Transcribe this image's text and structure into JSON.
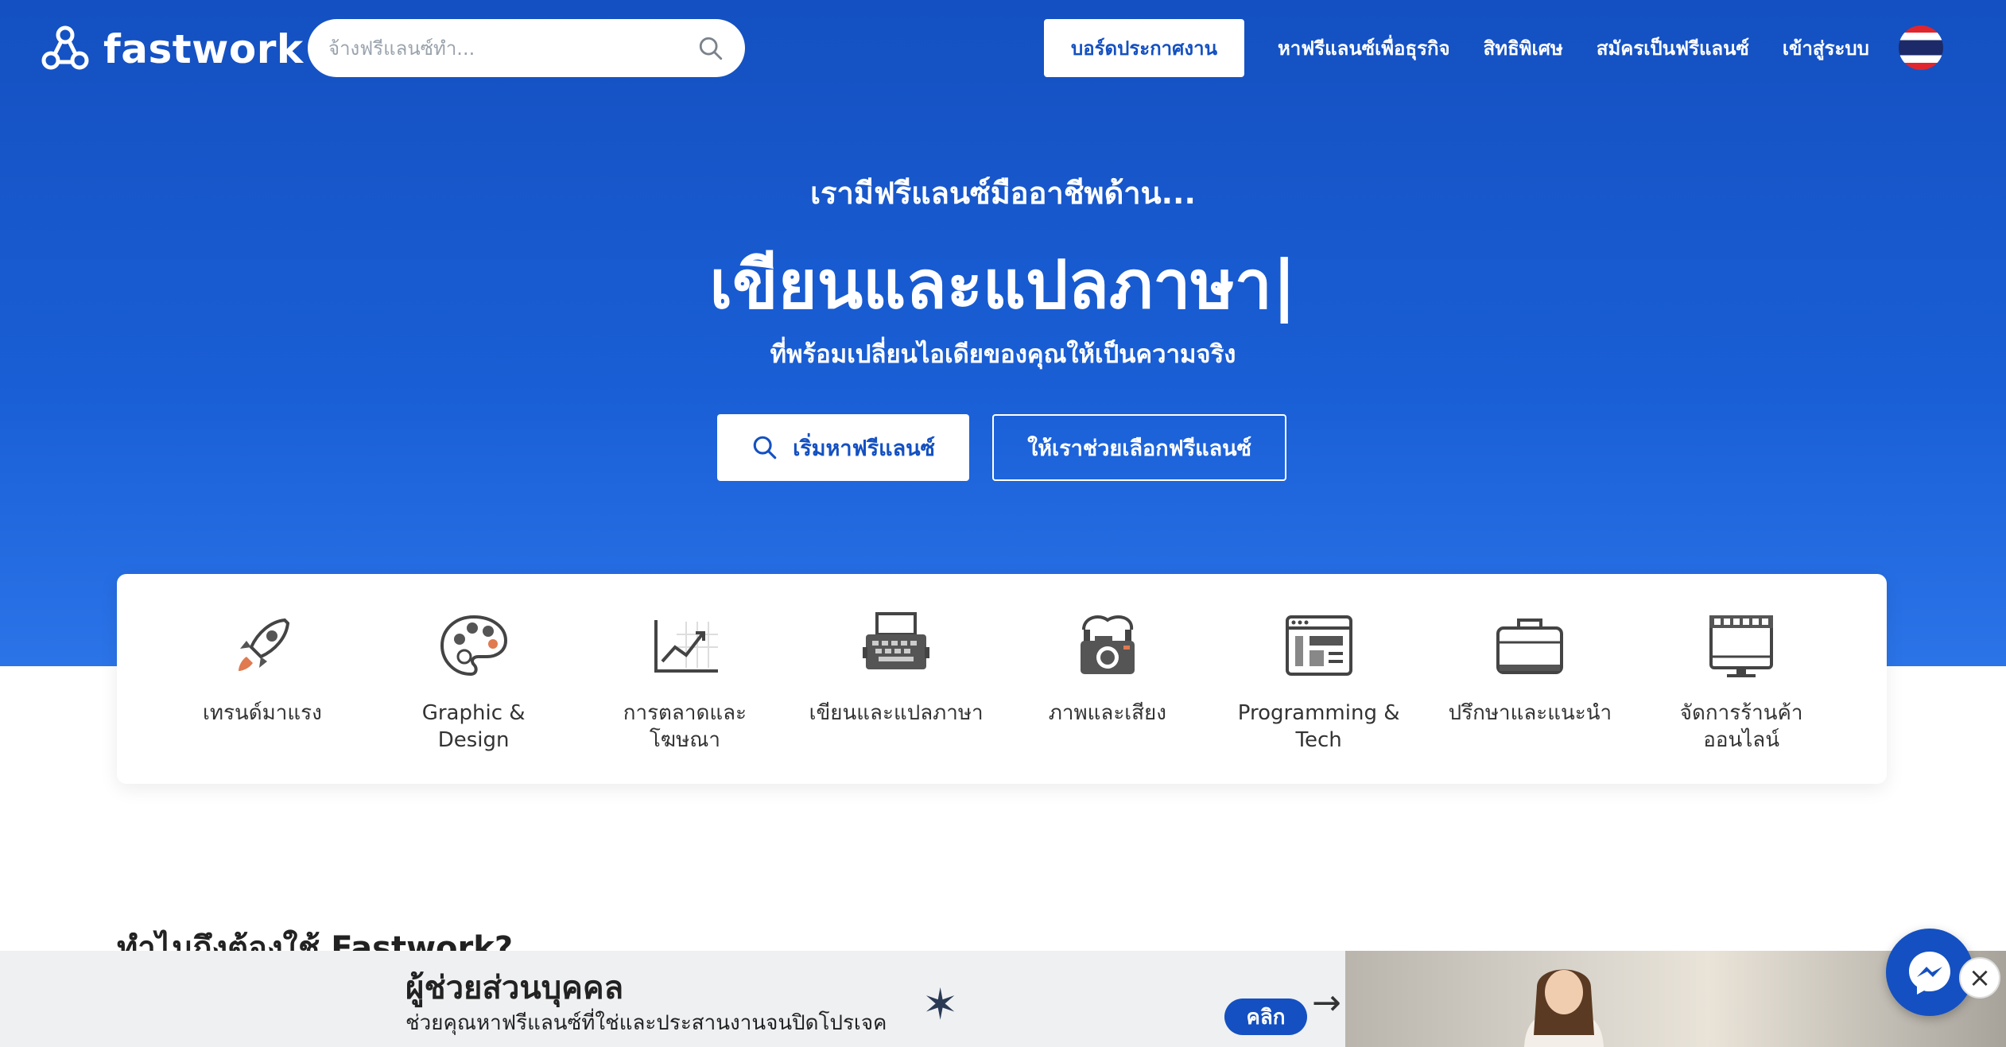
{
  "brand": {
    "name": "fastwork"
  },
  "search": {
    "placeholder": "จ้างฟรีแลนซ์ทำ..."
  },
  "nav": {
    "board": "บอร์ดประกาศงาน",
    "links": [
      "หาฟรีแลนซ์เพื่อธุรกิจ",
      "สิทธิพิเศษ",
      "สมัครเป็นฟรีแลนซ์",
      "เข้าสู่ระบบ"
    ]
  },
  "hero": {
    "kicker": "เรามีฟรีแลนซ์มืออาชีพด้าน...",
    "title": "เขียนและแปลภาษา|",
    "subtitle": "ที่พร้อมเปลี่ยนไอเดียของคุณให้เป็นความจริง",
    "primary_button": "เริ่มหาฟรีแลนซ์",
    "secondary_button": "ให้เราช่วยเลือกฟรีแลนซ์"
  },
  "categories": [
    {
      "label": "เทรนด์มาแรง",
      "icon": "rocket-icon"
    },
    {
      "label": "Graphic & Design",
      "icon": "palette-icon"
    },
    {
      "label": "การตลาดและโฆษณา",
      "icon": "chart-icon"
    },
    {
      "label": "เขียนและแปลภาษา",
      "icon": "typewriter-icon"
    },
    {
      "label": "ภาพและเสียง",
      "icon": "camera-icon"
    },
    {
      "label": "Programming & Tech",
      "icon": "browser-icon"
    },
    {
      "label": "ปรึกษาและแนะนำ",
      "icon": "briefcase-icon"
    },
    {
      "label": "จัดการร้านค้าออนไลน์",
      "icon": "storefront-icon"
    }
  ],
  "section": {
    "why": "ทำไมถึงต้องใช้ Fastwork?"
  },
  "banner": {
    "title": "ผู้ช่วยส่วนบุคคล",
    "subtitle": "ช่วยคุณหาฟรีแลนซ์ที่ใช่และประสานงานจนปิดโปรเจค",
    "button": "คลิก",
    "close": "×"
  },
  "colors": {
    "primary": "#1450c1",
    "hero_bottom": "#2b74e8"
  }
}
